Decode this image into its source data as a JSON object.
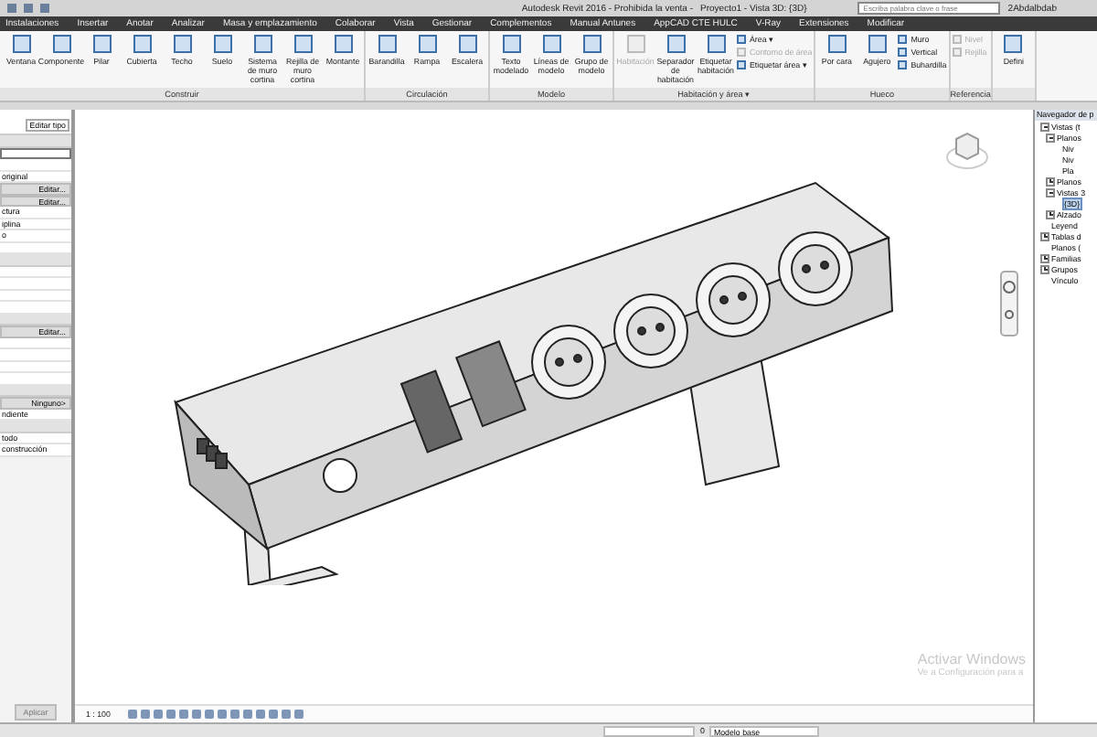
{
  "window": {
    "title": "Autodesk Revit 2016 - Prohibida la venta -",
    "document": "Proyecto1 - Vista 3D: {3D}",
    "search": {
      "placeholder": "Escriba palabra clave o frase"
    },
    "user": "2Abdalbdab"
  },
  "menu_tabs": [
    {
      "label": "Instalaciones",
      "selected": false
    },
    {
      "label": "Insertar",
      "selected": false
    },
    {
      "label": "Anotar",
      "selected": false
    },
    {
      "label": "Analizar",
      "selected": false
    },
    {
      "label": "Masa y emplazamiento",
      "selected": false
    },
    {
      "label": "Colaborar",
      "selected": false
    },
    {
      "label": "Vista",
      "selected": false
    },
    {
      "label": "Gestionar",
      "selected": false
    },
    {
      "label": "Complementos",
      "selected": false
    },
    {
      "label": "Manual Antunes",
      "selected": false
    },
    {
      "label": "AppCAD CTE HULC",
      "selected": false
    },
    {
      "label": "V-Ray",
      "selected": false
    },
    {
      "label": "Extensiones",
      "selected": false
    },
    {
      "label": "Modificar",
      "selected": false
    }
  ],
  "ribbon": [
    {
      "title": "Construir",
      "tools": [
        {
          "kind": "large",
          "label": "Ventana",
          "disabled": false
        },
        {
          "kind": "large",
          "label": "Componente",
          "disabled": false
        },
        {
          "kind": "large",
          "label": "Pilar",
          "disabled": false
        },
        {
          "kind": "large",
          "label": "Cubierta",
          "disabled": false
        },
        {
          "kind": "large",
          "label": "Techo",
          "disabled": false
        },
        {
          "kind": "large",
          "label": "Suelo",
          "disabled": false
        },
        {
          "kind": "large",
          "label": "Sistema de muro cortina",
          "disabled": false
        },
        {
          "kind": "large",
          "label": "Rejilla de muro cortina",
          "disabled": false
        },
        {
          "kind": "large",
          "label": "Montante",
          "disabled": false
        }
      ]
    },
    {
      "title": "Circulación",
      "tools": [
        {
          "kind": "large",
          "label": "Barandilla",
          "disabled": false
        },
        {
          "kind": "large",
          "label": "Rampa",
          "disabled": false
        },
        {
          "kind": "large",
          "label": "Escalera",
          "disabled": false
        }
      ]
    },
    {
      "title": "Modelo",
      "tools": [
        {
          "kind": "large",
          "label": "Texto modelado",
          "disabled": false
        },
        {
          "kind": "large",
          "label": "Líneas de modelo",
          "disabled": false
        },
        {
          "kind": "large",
          "label": "Grupo de modelo",
          "disabled": false
        }
      ]
    },
    {
      "title": "Habitación y área ▾",
      "tools": [
        {
          "kind": "large",
          "label": "Habitación",
          "disabled": true
        },
        {
          "kind": "large",
          "label": "Separador de habitación",
          "disabled": false
        },
        {
          "kind": "large",
          "label": "Etiquetar habitación",
          "disabled": false
        },
        {
          "kind": "small",
          "label": "Área ▾",
          "disabled": false
        },
        {
          "kind": "small",
          "label": "Contorno de área",
          "disabled": true
        },
        {
          "kind": "small",
          "label": "Etiquetar área ▾",
          "disabled": false
        }
      ]
    },
    {
      "title": "Hueco",
      "tools": [
        {
          "kind": "large",
          "label": "Por cara",
          "disabled": false
        },
        {
          "kind": "large",
          "label": "Agujero",
          "disabled": false
        },
        {
          "kind": "small",
          "label": "Muro",
          "disabled": false
        },
        {
          "kind": "small",
          "label": "Vertical",
          "disabled": false
        },
        {
          "kind": "small",
          "label": "Buhardilla",
          "disabled": false
        }
      ]
    },
    {
      "title": "Referencia",
      "tools": [
        {
          "kind": "small",
          "label": "Nivel",
          "disabled": true
        },
        {
          "kind": "small",
          "label": "Rejilla",
          "disabled": true
        }
      ]
    },
    {
      "tools": [
        {
          "kind": "large",
          "label": "Defini",
          "disabled": false
        }
      ]
    }
  ],
  "properties": {
    "edit_type": "Editar tipo",
    "rows": [
      {
        "kind": "header"
      },
      {
        "kind": "field"
      },
      {
        "kind": "text",
        "text": ""
      },
      {
        "kind": "text",
        "text": "original"
      },
      {
        "kind": "button",
        "text": "Editar..."
      },
      {
        "kind": "button",
        "text": "Editar..."
      },
      {
        "kind": "text",
        "text": "ctura"
      },
      {
        "kind": "text",
        "text": "iplina"
      },
      {
        "kind": "text",
        "text": "o"
      },
      {
        "kind": "text",
        "text": ""
      },
      {
        "kind": "header"
      },
      {
        "kind": "text",
        "text": ""
      },
      {
        "kind": "text",
        "text": ""
      },
      {
        "kind": "text",
        "text": ""
      },
      {
        "kind": "text",
        "text": ""
      },
      {
        "kind": "header"
      },
      {
        "kind": "button",
        "text": "Editar..."
      },
      {
        "kind": "text",
        "text": ""
      },
      {
        "kind": "text",
        "text": ""
      },
      {
        "kind": "text",
        "text": ""
      },
      {
        "kind": "text",
        "text": ""
      },
      {
        "kind": "header"
      },
      {
        "kind": "button",
        "text": "Ninguno>"
      },
      {
        "kind": "text",
        "text": "ndiente"
      },
      {
        "kind": "header"
      },
      {
        "kind": "text",
        "text": "todo"
      },
      {
        "kind": "text",
        "text": "construcción"
      }
    ],
    "apply": "Aplicar"
  },
  "view_bar": {
    "scale": "1 : 100"
  },
  "browser": {
    "title": "Navegador de p",
    "tree": [
      {
        "label": "Vistas (t",
        "expanded": true,
        "selected": false,
        "children": [
          {
            "label": "Planos",
            "expanded": true,
            "selected": false,
            "children": [
              {
                "label": "Niv",
                "selected": false
              },
              {
                "label": "Niv",
                "selected": false
              },
              {
                "label": "Pla",
                "selected": false
              }
            ]
          },
          {
            "label": "Planos",
            "expanded": false,
            "selected": false
          },
          {
            "label": "Vistas 3",
            "expanded": true,
            "selected": false,
            "children": [
              {
                "label": "{3D}",
                "selected": true
              }
            ]
          },
          {
            "label": "Alzado",
            "expanded": false,
            "selected": false
          }
        ]
      },
      {
        "label": "Leyend",
        "selected": false
      },
      {
        "label": "Tablas d",
        "expanded": false,
        "selected": false
      },
      {
        "label": "Planos (",
        "selected": false
      },
      {
        "label": "Familias",
        "expanded": false,
        "selected": false
      },
      {
        "label": "Grupos",
        "expanded": false,
        "selected": false
      },
      {
        "label": "Vínculo",
        "selected": false
      }
    ]
  },
  "activation": {
    "title": "Activar Windows",
    "subtitle": "Ve a Configuración para a"
  },
  "status_bar": {
    "workset": "0",
    "design_option": "Modelo base"
  }
}
